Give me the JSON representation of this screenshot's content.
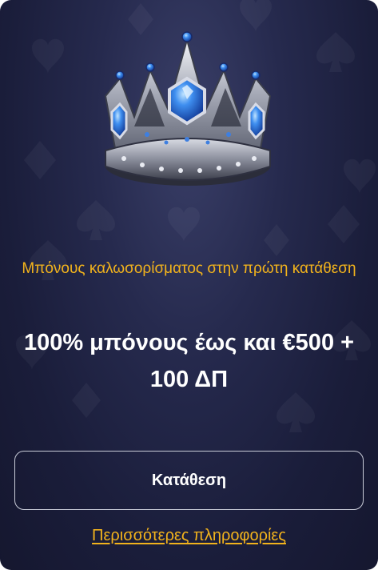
{
  "promo": {
    "image_icon": "crown-icon",
    "headline_top": "Μπόνους καλωσορίσματος στην πρώτη κατάθεση",
    "headline_main": "100% μπόνους έως και €500 + 100 ΔΠ",
    "deposit_label": "Κατάθεση",
    "more_info_label": "Περισσότερες πληροφορίες"
  },
  "colors": {
    "background": "#1f2242",
    "accent": "#f2b31c",
    "text": "#ffffff",
    "button_border": "#c9ccd8"
  }
}
